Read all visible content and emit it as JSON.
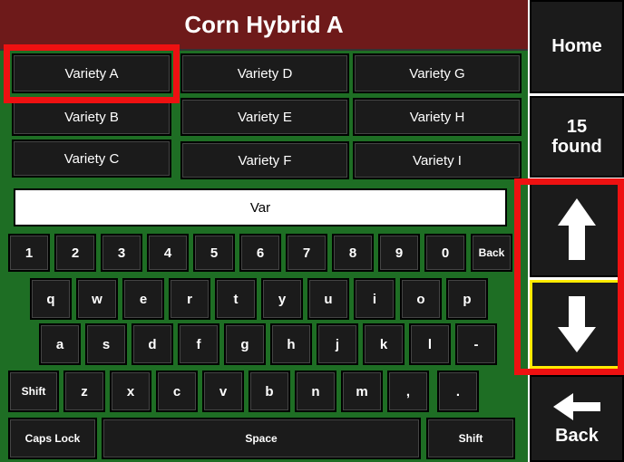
{
  "header": {
    "title": "Corn Hybrid A"
  },
  "varieties": [
    "Variety A",
    "Variety D",
    "Variety G",
    "Variety B",
    "Variety E",
    "Variety H",
    "Variety C",
    "Variety F",
    "Variety I"
  ],
  "search": {
    "value": "Var"
  },
  "keyboard": {
    "row1": [
      "1",
      "2",
      "3",
      "4",
      "5",
      "6",
      "7",
      "8",
      "9",
      "0",
      "Back"
    ],
    "row2": [
      "q",
      "w",
      "e",
      "r",
      "t",
      "y",
      "u",
      "i",
      "o",
      "p"
    ],
    "row3": [
      "a",
      "s",
      "d",
      "f",
      "g",
      "h",
      "j",
      "k",
      "l",
      "-"
    ],
    "row4": [
      "Shift",
      "z",
      "x",
      "c",
      "v",
      "b",
      "n",
      "m",
      ",",
      "."
    ],
    "row5": [
      "Caps Lock",
      "Space",
      "Shift"
    ]
  },
  "sidebar": {
    "home_label": "Home",
    "found_count": "15",
    "found_label": "found",
    "up_icon": "arrow-up-icon",
    "down_icon": "arrow-down-icon",
    "back_label": "Back",
    "back_icon": "arrow-left-icon"
  },
  "colors": {
    "background": "#1e6e24",
    "title_bar": "#6e1a1a",
    "button": "#1b1b1b",
    "highlight": "#ee1111",
    "selected_outline": "#ffea00"
  }
}
